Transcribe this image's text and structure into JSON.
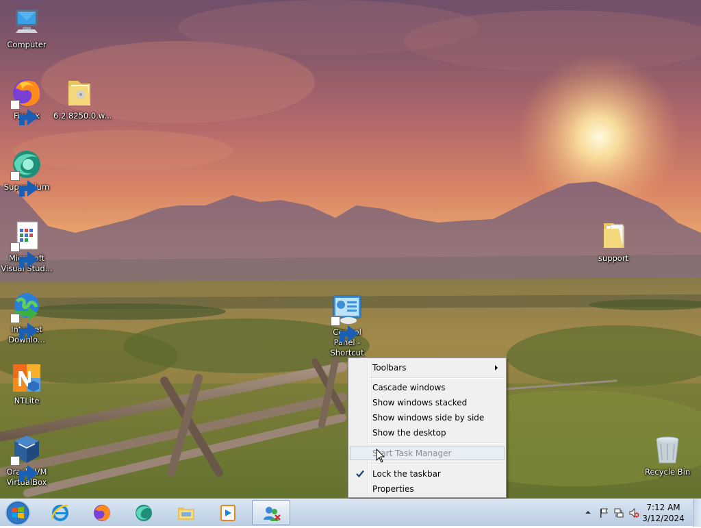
{
  "desktop": {
    "icons": [
      {
        "name": "computer",
        "label": "Computer"
      },
      {
        "name": "firefox",
        "label": "Firefox"
      },
      {
        "name": "folder-6-2",
        "label": "6.2.8250.0.w..."
      },
      {
        "name": "supermium",
        "label": "Supermium"
      },
      {
        "name": "ms-visual-studio",
        "label": "Microsoft Visual Stud..."
      },
      {
        "name": "support",
        "label": "support"
      },
      {
        "name": "internet-download",
        "label": "Internet Downlo..."
      },
      {
        "name": "control-panel",
        "label": "Control Panel - Shortcut"
      },
      {
        "name": "ntlite",
        "label": "NTLite"
      },
      {
        "name": "virtualbox",
        "label": "Oracle VM VirtualBox"
      },
      {
        "name": "recycle-bin",
        "label": "Recycle Bin"
      }
    ]
  },
  "context_menu": {
    "items": [
      {
        "label": "Toolbars",
        "submenu": true
      },
      {
        "label": "Cascade windows"
      },
      {
        "label": "Show windows stacked"
      },
      {
        "label": "Show windows side by side"
      },
      {
        "label": "Show the desktop"
      },
      {
        "label": "Start Task Manager",
        "disabled": true,
        "hover": true
      },
      {
        "label": "Lock the taskbar",
        "checked": true
      },
      {
        "label": "Properties"
      }
    ]
  },
  "taskbar": {
    "pinned": [
      "internet-explorer-icon",
      "firefox-icon",
      "supermium-icon",
      "file-explorer-icon",
      "media-player-icon",
      "users-app-icon"
    ],
    "active_index": 5,
    "tray": {
      "time": "7:12 AM",
      "date": "3/12/2024"
    }
  },
  "colors": {
    "menu_bg": "#f0f0f0",
    "taskbar_top": "#dbe7f3",
    "taskbar_bottom": "#b9cde2"
  }
}
